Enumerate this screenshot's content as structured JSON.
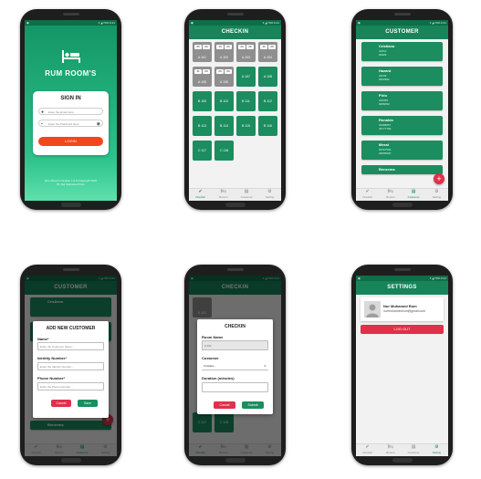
{
  "status": {
    "left": "▣",
    "right": "▾ ◢ 79% 6:21"
  },
  "nav": [
    {
      "icon": "✔",
      "label": "Checkin"
    },
    {
      "icon": "🛏",
      "label": "Rooms"
    },
    {
      "icon": "▤",
      "label": "Customer"
    },
    {
      "icon": "⚙",
      "label": "Setting"
    }
  ],
  "login": {
    "brand": "RUM ROOM'S",
    "title": "SIGN IN",
    "email_placeholder": "Enter the Email Here",
    "password_placeholder": "Enter the Password Here",
    "button": "LOGIN",
    "copyright": "Rum Room's Version 1.0.0 Copyright 2018",
    "author": "By Nur Muhamed Rum"
  },
  "checkin": {
    "title": "CHECKIN",
    "rooms": [
      {
        "name": "A 101",
        "state": "occupied",
        "badges": [
          "05",
          "09"
        ]
      },
      {
        "name": "A 102",
        "state": "occupied",
        "badges": [
          "19",
          "09"
        ]
      },
      {
        "name": "A 103",
        "state": "occupied",
        "badges": [
          "29",
          "09"
        ]
      },
      {
        "name": "A 104",
        "state": "occupied",
        "badges": [
          "49",
          "09"
        ]
      },
      {
        "name": "A 105",
        "state": "occupied",
        "badges": [
          "31",
          "09"
        ]
      },
      {
        "name": "A 106",
        "state": "occupied",
        "badges": [
          "29",
          "09"
        ]
      },
      {
        "name": "A 107",
        "state": "free"
      },
      {
        "name": "A 108",
        "state": "free"
      },
      {
        "name": "B 109",
        "state": "free"
      },
      {
        "name": "B 110",
        "state": "free"
      },
      {
        "name": "B 111",
        "state": "free"
      },
      {
        "name": "B 112",
        "state": "free"
      },
      {
        "name": "B 113",
        "state": "free"
      },
      {
        "name": "B 114",
        "state": "free"
      },
      {
        "name": "B 115",
        "state": "free"
      },
      {
        "name": "B 116",
        "state": "free"
      },
      {
        "name": "C 117",
        "state": "free"
      },
      {
        "name": "C 118",
        "state": "free"
      }
    ]
  },
  "customers": {
    "title": "CUSTOMER",
    "items": [
      {
        "name": "Cristiano",
        "line1": "4/4/10",
        "line2": "02929"
      },
      {
        "name": "Hazard",
        "line1": "23/4/9",
        "line2": "0622992"
      },
      {
        "name": "Pirlo",
        "line1": "4/25/55",
        "line2": "0066090"
      },
      {
        "name": "Ronaldo",
        "line1": "02988067",
        "line2": "46777790"
      },
      {
        "name": "Messi",
        "line1": "09767530",
        "line2": "00609030"
      },
      {
        "name": "Benzema",
        "line1": "",
        "line2": ""
      }
    ],
    "fab": "+"
  },
  "add_customer": {
    "title": "ADD NEW CUSTOMER",
    "name_label": "Name*",
    "name_placeholder": "Enter the Customer Name...",
    "identity_label": "Identity Number*",
    "identity_placeholder": "Enter the Identity Number...",
    "phone_label": "Phone Number*",
    "phone_placeholder": "Enter the Phone Number...",
    "cancel": "Cancel",
    "save": "Save"
  },
  "checkin_dialog": {
    "title": "CHECKIN",
    "room_label": "Room Name",
    "room_value": "A 101",
    "customer_label": "Customer",
    "customer_value": "Cristiano",
    "duration_label": "Duration (minutes)",
    "cancel": "Cancel",
    "submit": "Submit"
  },
  "settings": {
    "title": "SETTINGS",
    "name": "Nur Muhamed Rum",
    "email": "nurmuhamedrum@gmail.com",
    "logout": "LOG OUT"
  },
  "colors": {
    "primary": "#18845a",
    "dark": "#0e6e47",
    "accent": "#e0304a",
    "login_button": "#f2461c"
  }
}
